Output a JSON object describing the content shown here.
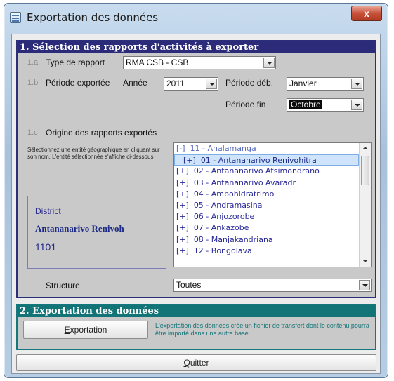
{
  "window": {
    "title": "Exportation des données",
    "close_label": "x"
  },
  "section1": {
    "header": "1. Sélection des rapports d'activités à exporter",
    "type_rapport": {
      "step": "1.a",
      "label": "Type de rapport",
      "value": "RMA CSB - CSB"
    },
    "periode": {
      "step": "1.b",
      "label": "Période exportée",
      "annee_label": "Année",
      "annee_value": "2011",
      "debut_label": "Période déb.",
      "debut_value": "Janvier",
      "fin_label": "Période fin",
      "fin_value": "Octobre"
    },
    "origine": {
      "step": "1.c",
      "label": "Origine des rapports exportés",
      "help_text": "Sélectionnez une entité géographique en cliquant sur son nom. L'entité sélectionnée s'affiche ci-dessous"
    },
    "district": {
      "label": "District",
      "name": "Antananarivo Renivoh",
      "code": "1101"
    },
    "tree": [
      {
        "prefix": "[-]",
        "text": "11 - Analamanga",
        "level": 0
      },
      {
        "prefix": "[+]",
        "text": "01 - Antananarivo Renivohitra",
        "level": 1,
        "selected": true
      },
      {
        "prefix": "[+]",
        "text": "02 - Antananarivo Atsimondrano",
        "level": 1
      },
      {
        "prefix": "[+]",
        "text": "03 - Antananarivo Avaradr",
        "level": 1
      },
      {
        "prefix": "[+]",
        "text": "04 - Ambohidratrimo",
        "level": 1
      },
      {
        "prefix": "[+]",
        "text": "05 - Andramasina",
        "level": 1
      },
      {
        "prefix": "[+]",
        "text": "06 - Anjozorobe",
        "level": 1
      },
      {
        "prefix": "[+]",
        "text": "07 - Ankazobe",
        "level": 1
      },
      {
        "prefix": "[+]",
        "text": "08 - Manjakandriana",
        "level": 1
      },
      {
        "prefix": "[+]",
        "text": "12 - Bongolava",
        "level": 0
      }
    ],
    "structure": {
      "label": "Structure",
      "value": "Toutes"
    }
  },
  "section2": {
    "header": "2. Exportation des données",
    "export_button": "Exportation",
    "note": "L'exportation des données crée un fichier de transfert dont le contenu pourra être importé dans une autre base"
  },
  "quit_button": "Quitter"
}
